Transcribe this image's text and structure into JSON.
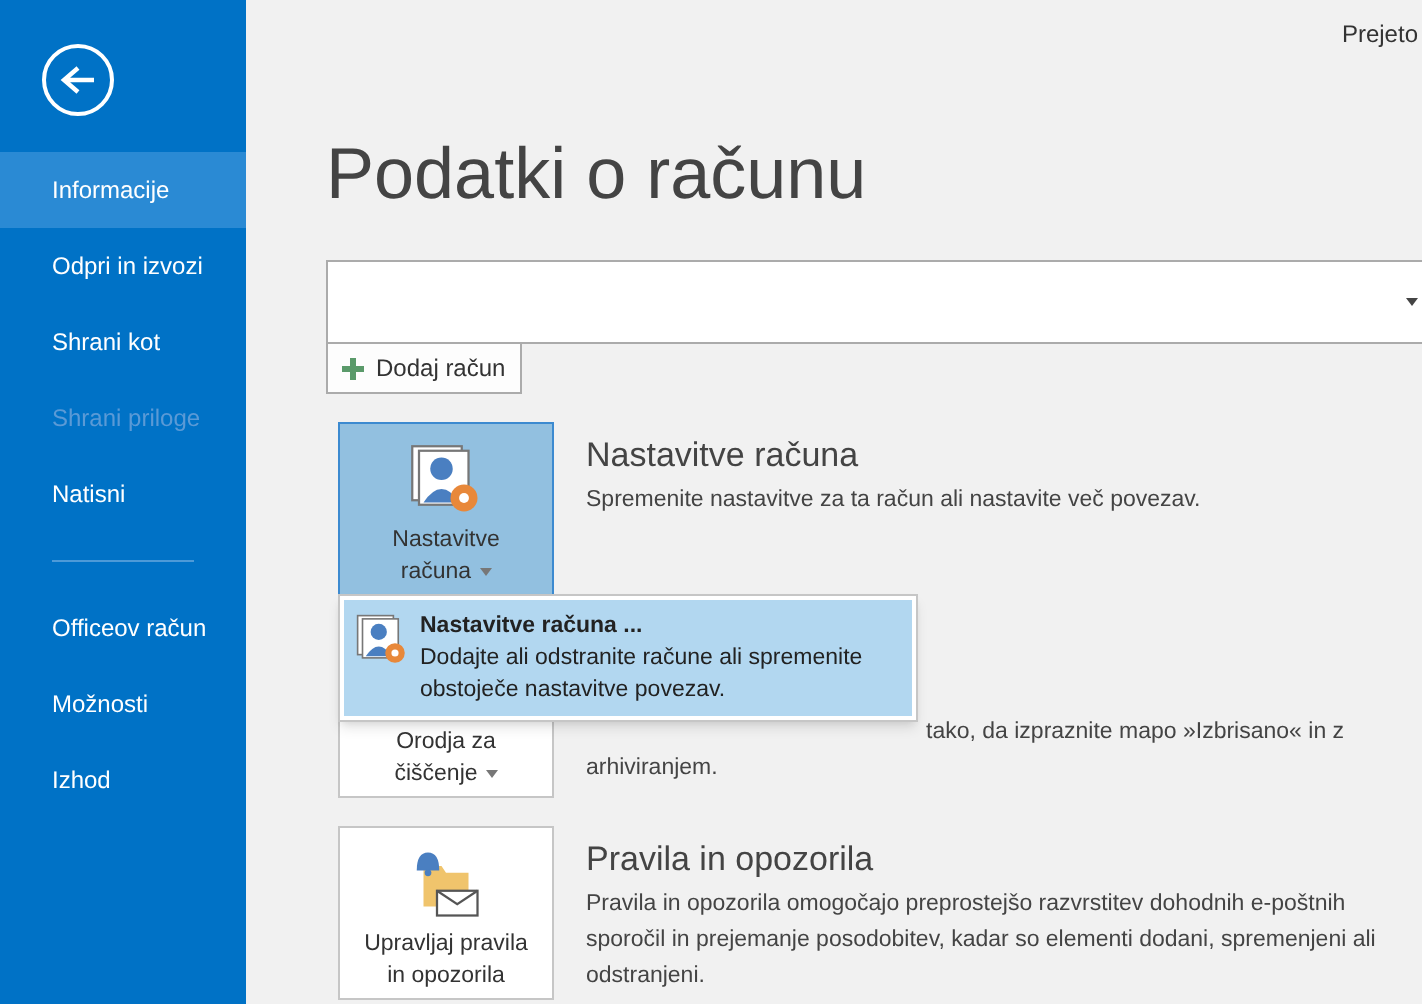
{
  "top_right": "Prejeto",
  "sidebar": {
    "groups": [
      [
        {
          "label": "Informacije",
          "selected": true,
          "disabled": false
        },
        {
          "label": "Odpri in izvozi",
          "selected": false,
          "disabled": false
        },
        {
          "label": "Shrani kot",
          "selected": false,
          "disabled": false
        },
        {
          "label": "Shrani priloge",
          "selected": false,
          "disabled": true
        },
        {
          "label": "Natisni",
          "selected": false,
          "disabled": false
        }
      ],
      [
        {
          "label": "Officeov račun",
          "selected": false,
          "disabled": false
        },
        {
          "label": "Možnosti",
          "selected": false,
          "disabled": false
        },
        {
          "label": "Izhod",
          "selected": false,
          "disabled": false
        }
      ]
    ]
  },
  "heading": "Podatki o računu",
  "add_account": "Dodaj račun",
  "sections": [
    {
      "kind": "settings",
      "button": [
        "Nastavitve",
        "računa"
      ],
      "pressed": true,
      "title": "Nastavitve računa",
      "description": "Spremenite nastavitve za ta račun ali nastavite več povezav."
    },
    {
      "kind": "cleanup",
      "button": [
        "Orodja za",
        "čiščenje"
      ],
      "pressed": false,
      "description": "tako, da izpraznite mapo »Izbrisano« in z arhiviranjem."
    },
    {
      "kind": "rules",
      "button": [
        "Upravljaj pravila",
        "in opozorila"
      ],
      "pressed": false,
      "title": "Pravila in opozorila",
      "description": "Pravila in opozorila omogočajo preprostejšo razvrstitev dohodnih e-poštnih sporočil in prejemanje posodobitev, kadar so elementi dodani, spremenjeni ali odstranjeni."
    }
  ],
  "menu": {
    "title": "Nastavitve računa ...",
    "description": "Dodajte ali odstranite račune ali spremenite obstoječe nastavitve povezav."
  }
}
